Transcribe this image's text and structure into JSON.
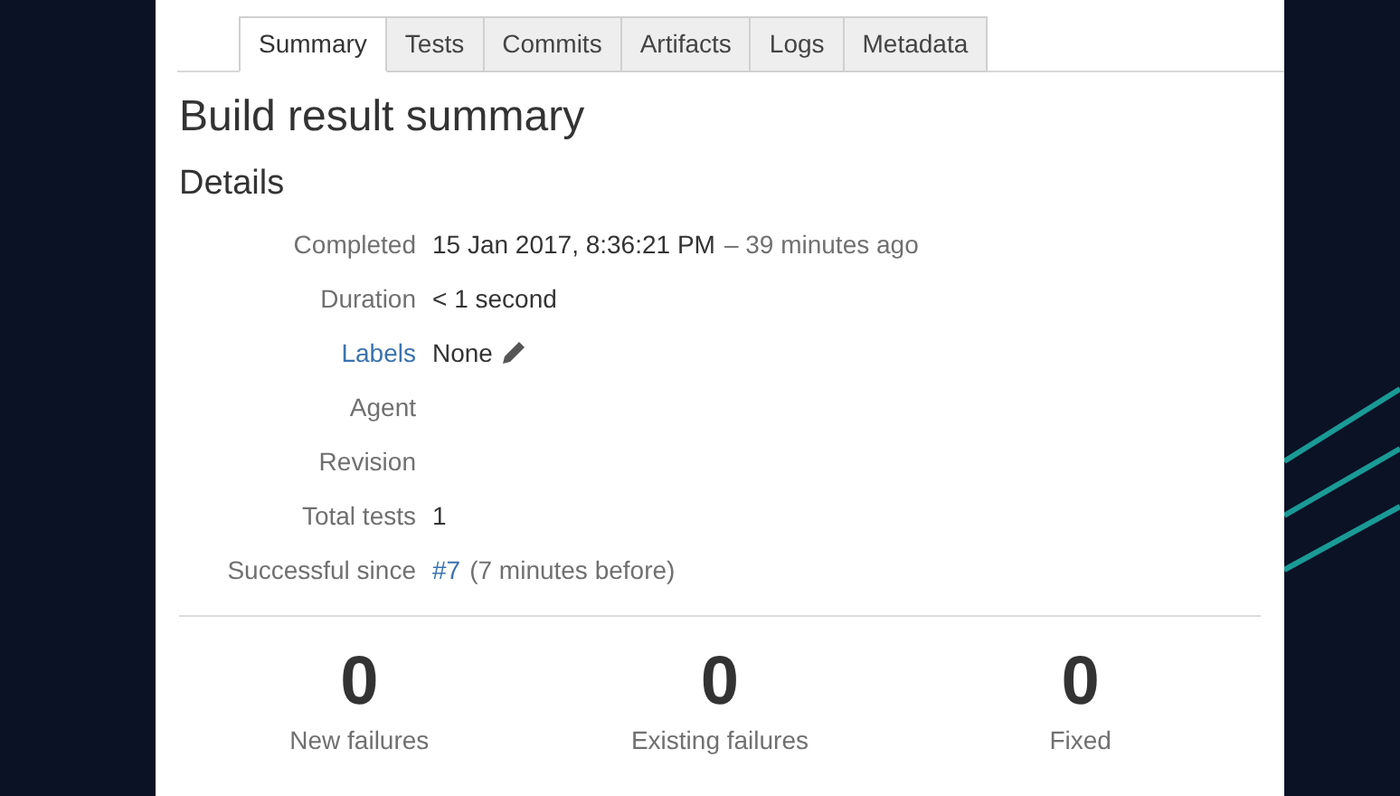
{
  "tabs": [
    {
      "label": "Summary",
      "selected": true
    },
    {
      "label": "Tests",
      "selected": false
    },
    {
      "label": "Commits",
      "selected": false
    },
    {
      "label": "Artifacts",
      "selected": false
    },
    {
      "label": "Logs",
      "selected": false
    },
    {
      "label": "Metadata",
      "selected": false
    }
  ],
  "heading": "Build result summary",
  "section": "Details",
  "details": [
    {
      "label": "Completed",
      "value": "15 Jan 2017, 8:36:21 PM",
      "note": "– 39 minutes ago"
    },
    {
      "label": "Duration",
      "value": "< 1 second"
    },
    {
      "label": "Labels",
      "label_link": true,
      "value": "None",
      "editable": true
    },
    {
      "label": "Agent"
    },
    {
      "label": "Revision"
    },
    {
      "label": "Total tests",
      "value": "1"
    },
    {
      "label": "Successful since",
      "value": "#7",
      "value_link": true,
      "note": "(7 minutes before)"
    }
  ],
  "stats": [
    {
      "value": "0",
      "label": "New failures"
    },
    {
      "value": "0",
      "label": "Existing failures"
    },
    {
      "value": "0",
      "label": "Fixed"
    }
  ]
}
